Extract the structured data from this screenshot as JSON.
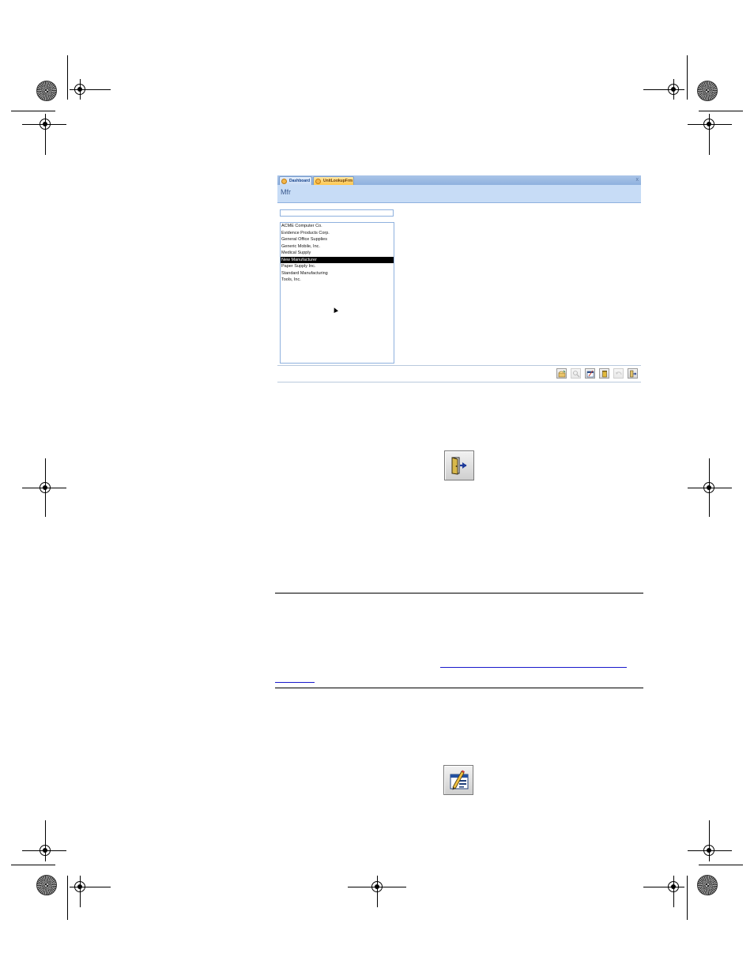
{
  "window": {
    "tabs": [
      {
        "label": "Dashboard",
        "active": false
      },
      {
        "label": "UnitLookupFrm",
        "active": true
      }
    ],
    "close_glyph": "x",
    "form_title": "Mfr",
    "search_value": "",
    "list_items": [
      "ACME Computer Co.",
      "Evidence Products Corp.",
      "General Office Supplies",
      "Generic Mobile, Inc.",
      "Medical Supply",
      "New Manufacturer",
      "Paper Supply Inc.",
      "Standard Manufacturing",
      "Tools, Inc."
    ],
    "selected_item": "New Manufacturer",
    "toolbar_icons": [
      "new-record-icon",
      "filter-icon",
      "edit-record-icon",
      "delete-icon",
      "undo-icon",
      "exit-icon"
    ]
  },
  "standalone_icons": [
    "exit-door-icon",
    "edit-form-icon"
  ],
  "colors": {
    "tabstrip": "#8fb1de",
    "header": "#c7dcf6",
    "title": "#3b5a8e",
    "active_tab": "#ffc64d",
    "link": "#1a1acc"
  }
}
